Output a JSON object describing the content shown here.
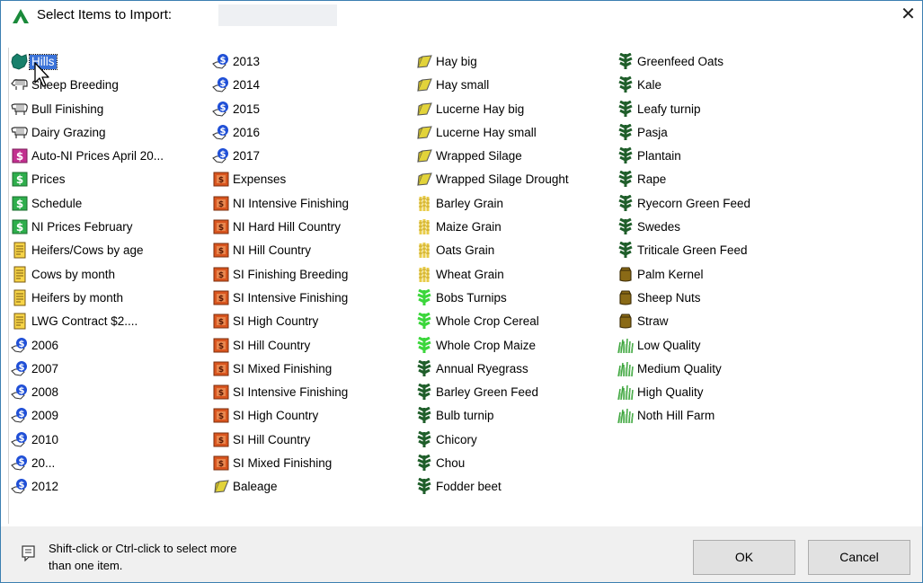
{
  "window": {
    "title": "Select Items to Import:",
    "close_glyph": "✕",
    "accent": "#3c7fb1"
  },
  "items": [
    {
      "label": "Hills",
      "icon": "farm-map-icon",
      "selected": true
    },
    {
      "label": "Sheep Breeding",
      "icon": "sheep-icon"
    },
    {
      "label": "Bull Finishing",
      "icon": "cattle-icon"
    },
    {
      "label": "Dairy Grazing",
      "icon": "cattle-icon"
    },
    {
      "label": "Auto-NI Prices April 20...",
      "icon": "auto-price-icon"
    },
    {
      "label": "Prices",
      "icon": "price-icon"
    },
    {
      "label": "Schedule",
      "icon": "price-icon"
    },
    {
      "label": "NI Prices February",
      "icon": "price-icon"
    },
    {
      "label": "Heifers/Cows by age",
      "icon": "report-icon"
    },
    {
      "label": "Cows by month",
      "icon": "report-icon"
    },
    {
      "label": "Heifers by month",
      "icon": "report-icon"
    },
    {
      "label": "LWG Contract $2....",
      "icon": "report-icon"
    },
    {
      "label": "2006",
      "icon": "year-price-icon"
    },
    {
      "label": "2007",
      "icon": "year-price-icon"
    },
    {
      "label": "2008",
      "icon": "year-price-icon"
    },
    {
      "label": "2009",
      "icon": "year-price-icon"
    },
    {
      "label": "2010",
      "icon": "year-price-icon"
    },
    {
      "label": "20...",
      "icon": "year-price-icon"
    },
    {
      "label": "2012",
      "icon": "year-price-icon"
    },
    {
      "label": "2013",
      "icon": "year-price-icon"
    },
    {
      "label": "2014",
      "icon": "year-price-icon"
    },
    {
      "label": "2015",
      "icon": "year-price-icon"
    },
    {
      "label": "2016",
      "icon": "year-price-icon"
    },
    {
      "label": "2017",
      "icon": "year-price-icon"
    },
    {
      "label": "Expenses",
      "icon": "expenses-icon"
    },
    {
      "label": "NI Intensive Finishing",
      "icon": "expenses-icon"
    },
    {
      "label": "NI Hard Hill Country",
      "icon": "expenses-icon"
    },
    {
      "label": "NI Hill Country",
      "icon": "expenses-icon"
    },
    {
      "label": "SI Finishing Breeding",
      "icon": "expenses-icon"
    },
    {
      "label": "SI Intensive Finishing",
      "icon": "expenses-icon"
    },
    {
      "label": "SI High Country",
      "icon": "expenses-icon"
    },
    {
      "label": "SI Hill Country",
      "icon": "expenses-icon"
    },
    {
      "label": "SI Mixed Finishing",
      "icon": "expenses-icon"
    },
    {
      "label": "SI Intensive Finishing",
      "icon": "expenses-icon"
    },
    {
      "label": "SI High Country",
      "icon": "expenses-icon"
    },
    {
      "label": "SI Hill Country",
      "icon": "expenses-icon"
    },
    {
      "label": "SI Mixed Finishing",
      "icon": "expenses-icon"
    },
    {
      "label": "Baleage",
      "icon": "hay-bale-icon"
    },
    {
      "label": "Hay big",
      "icon": "hay-bale-icon"
    },
    {
      "label": "Hay small",
      "icon": "hay-bale-icon"
    },
    {
      "label": "Lucerne Hay big",
      "icon": "hay-bale-icon"
    },
    {
      "label": "Lucerne Hay small",
      "icon": "hay-bale-icon"
    },
    {
      "label": "Wrapped Silage",
      "icon": "hay-bale-icon"
    },
    {
      "label": "Wrapped Silage Drought",
      "icon": "hay-bale-icon"
    },
    {
      "label": "Barley Grain",
      "icon": "grain-icon"
    },
    {
      "label": "Maize Grain",
      "icon": "grain-icon"
    },
    {
      "label": "Oats Grain",
      "icon": "grain-icon"
    },
    {
      "label": "Wheat Grain",
      "icon": "grain-icon"
    },
    {
      "label": "Bobs Turnips",
      "icon": "green-crop-icon"
    },
    {
      "label": "Whole Crop Cereal",
      "icon": "green-crop-icon"
    },
    {
      "label": "Whole Crop Maize",
      "icon": "green-crop-icon"
    },
    {
      "label": "Annual Ryegrass",
      "icon": "forage-crop-icon"
    },
    {
      "label": "Barley Green Feed",
      "icon": "forage-crop-icon"
    },
    {
      "label": "Bulb turnip",
      "icon": "forage-crop-icon"
    },
    {
      "label": "Chicory",
      "icon": "forage-crop-icon"
    },
    {
      "label": "Chou",
      "icon": "forage-crop-icon"
    },
    {
      "label": "Fodder beet",
      "icon": "forage-crop-icon"
    },
    {
      "label": "Greenfeed Oats",
      "icon": "forage-crop-icon"
    },
    {
      "label": "Kale",
      "icon": "forage-crop-icon"
    },
    {
      "label": "Leafy turnip",
      "icon": "forage-crop-icon"
    },
    {
      "label": "Pasja",
      "icon": "forage-crop-icon"
    },
    {
      "label": "Plantain",
      "icon": "forage-crop-icon"
    },
    {
      "label": "Rape",
      "icon": "forage-crop-icon"
    },
    {
      "label": "Ryecorn Green Feed",
      "icon": "forage-crop-icon"
    },
    {
      "label": "Swedes",
      "icon": "forage-crop-icon"
    },
    {
      "label": "Triticale Green Feed",
      "icon": "forage-crop-icon"
    },
    {
      "label": "Palm Kernel",
      "icon": "feed-bag-icon"
    },
    {
      "label": "Sheep Nuts",
      "icon": "feed-bag-icon"
    },
    {
      "label": "Straw",
      "icon": "feed-bag-icon"
    },
    {
      "label": "Low Quality",
      "icon": "pasture-icon"
    },
    {
      "label": "Medium Quality",
      "icon": "pasture-icon"
    },
    {
      "label": "High Quality",
      "icon": "pasture-icon"
    },
    {
      "label": "Noth Hill Farm",
      "icon": "pasture-icon"
    }
  ],
  "footer": {
    "hint_line1": "Shift-click or Ctrl-click to select more",
    "hint_line2": "than one item.",
    "ok_label": "OK",
    "cancel_label": "Cancel"
  }
}
